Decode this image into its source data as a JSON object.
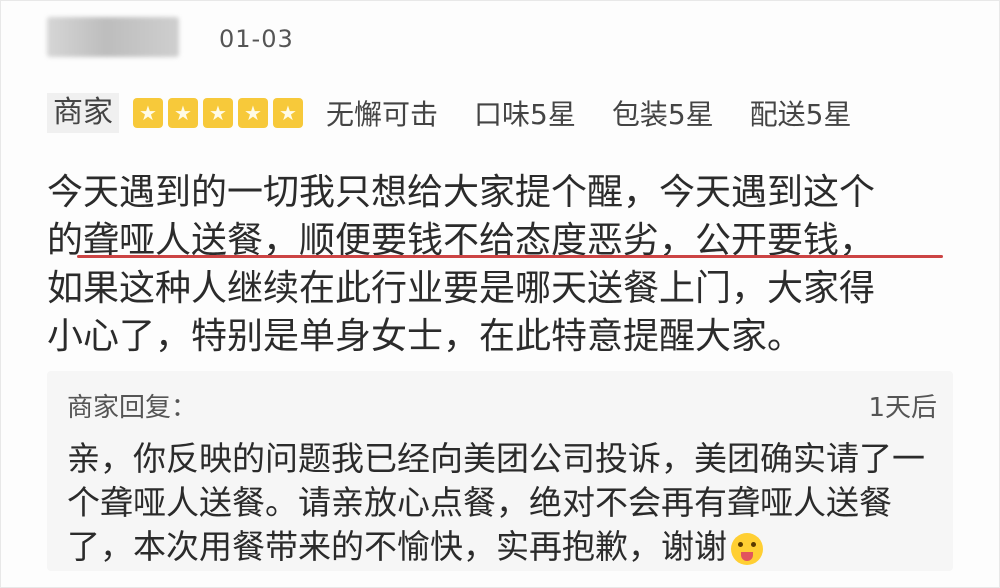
{
  "review": {
    "date": "01-03",
    "merchant_label": "商家",
    "stars": 5,
    "star_color": "#f7c93a",
    "rating_text": "无懈可击",
    "taste": "口味5星",
    "packaging": "包装5星",
    "delivery": "配送5星",
    "lines": [
      "今天遇到的一切我只想给大家提个醒，今天遇到这个",
      "的聋哑人送餐，顺便要钱不给态度恶劣，公开要钱，",
      "如果这种人继续在此行业要是哪天送餐上门，大家得",
      "小心了，特别是单身女士，在此特意提醒大家。"
    ]
  },
  "reply": {
    "label": "商家回复：",
    "time": "1天后",
    "lines": [
      "亲，你反映的问题我已经向美团公司投诉，美团确实请了一",
      "个聋哑人送餐。请亲放心点餐，绝对不会再有聋哑人送餐",
      "了，本次用餐带来的不愉快，实再抱歉，谢谢"
    ],
    "emoji": "squinting-tongue-emoji-icon"
  }
}
